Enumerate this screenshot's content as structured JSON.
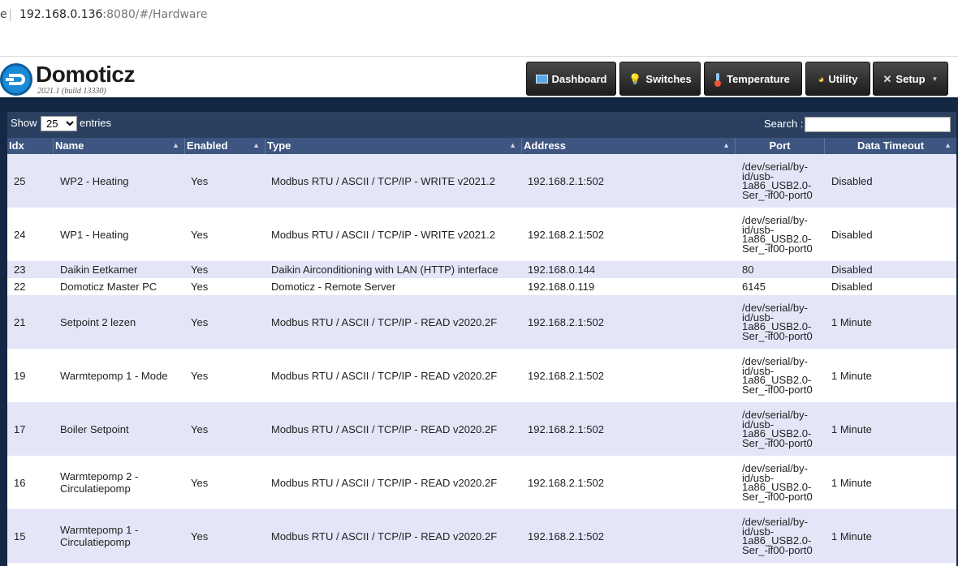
{
  "browser": {
    "edge_char": "e",
    "url_host": "192.168.0.136",
    "url_rest": ":8080/#/Hardware"
  },
  "header": {
    "brand": "Domoticz",
    "version": "2021.1 (build 13330)",
    "nav": [
      {
        "label": "Dashboard",
        "icon": "dashboard-icon"
      },
      {
        "label": "Switches",
        "icon": "lightbulb-icon"
      },
      {
        "label": "Temperature",
        "icon": "thermometer-icon"
      },
      {
        "label": "Utility",
        "icon": "utility-icon"
      },
      {
        "label": "Setup",
        "icon": "tools-icon"
      }
    ]
  },
  "table_controls": {
    "show_label": "Show",
    "page_size": "25",
    "entries_label": "entries",
    "search_label": "Search :",
    "search_value": ""
  },
  "columns": [
    "Idx",
    "Name",
    "Enabled",
    "Type",
    "Address",
    "Port",
    "Data Timeout"
  ],
  "rows": [
    {
      "idx": "25",
      "name": "WP2 - Heating",
      "enabled": "Yes",
      "type": "Modbus RTU / ASCII / TCP/IP - WRITE v2021.2",
      "address": "192.168.2.1:502",
      "port": [
        "/dev/serial/by-",
        "id/usb-",
        "1a86_USB2.0-",
        "Ser_-if00-port0"
      ],
      "timeout": "Disabled"
    },
    {
      "idx": "24",
      "name": "WP1 - Heating",
      "enabled": "Yes",
      "type": "Modbus RTU / ASCII / TCP/IP - WRITE v2021.2",
      "address": "192.168.2.1:502",
      "port": [
        "/dev/serial/by-",
        "id/usb-",
        "1a86_USB2.0-",
        "Ser_-if00-port0"
      ],
      "timeout": "Disabled"
    },
    {
      "idx": "23",
      "name": "Daikin Eetkamer",
      "enabled": "Yes",
      "type": "Daikin Airconditioning with LAN (HTTP) interface",
      "address": "192.168.0.144",
      "port": [
        "80"
      ],
      "timeout": "Disabled"
    },
    {
      "idx": "22",
      "name": "Domoticz Master PC",
      "enabled": "Yes",
      "type": "Domoticz - Remote Server",
      "address": "192.168.0.119",
      "port": [
        "6145"
      ],
      "timeout": "Disabled"
    },
    {
      "idx": "21",
      "name": "Setpoint 2 lezen",
      "enabled": "Yes",
      "type": "Modbus RTU / ASCII / TCP/IP - READ v2020.2F",
      "address": "192.168.2.1:502",
      "port": [
        "/dev/serial/by-",
        "id/usb-",
        "1a86_USB2.0-",
        "Ser_-if00-port0"
      ],
      "timeout": "1 Minute"
    },
    {
      "idx": "19",
      "name": "Warmtepomp 1 - Mode",
      "enabled": "Yes",
      "type": "Modbus RTU / ASCII / TCP/IP - READ v2020.2F",
      "address": "192.168.2.1:502",
      "port": [
        "/dev/serial/by-",
        "id/usb-",
        "1a86_USB2.0-",
        "Ser_-if00-port0"
      ],
      "timeout": "1 Minute"
    },
    {
      "idx": "17",
      "name": "Boiler Setpoint",
      "enabled": "Yes",
      "type": "Modbus RTU / ASCII / TCP/IP - READ v2020.2F",
      "address": "192.168.2.1:502",
      "port": [
        "/dev/serial/by-",
        "id/usb-",
        "1a86_USB2.0-",
        "Ser_-if00-port0"
      ],
      "timeout": "1 Minute"
    },
    {
      "idx": "16",
      "name": [
        "Warmtepomp 2 -",
        "Circulatiepomp"
      ],
      "enabled": "Yes",
      "type": "Modbus RTU / ASCII / TCP/IP - READ v2020.2F",
      "address": "192.168.2.1:502",
      "port": [
        "/dev/serial/by-",
        "id/usb-",
        "1a86_USB2.0-",
        "Ser_-if00-port0"
      ],
      "timeout": "1 Minute"
    },
    {
      "idx": "15",
      "name": [
        "Warmtepomp 1 -",
        "Circulatiepomp"
      ],
      "enabled": "Yes",
      "type": "Modbus RTU / ASCII / TCP/IP - READ v2020.2F",
      "address": "192.168.2.1:502",
      "port": [
        "/dev/serial/by-",
        "id/usb-",
        "1a86_USB2.0-",
        "Ser_-if00-port0"
      ],
      "timeout": "1 Minute"
    }
  ]
}
